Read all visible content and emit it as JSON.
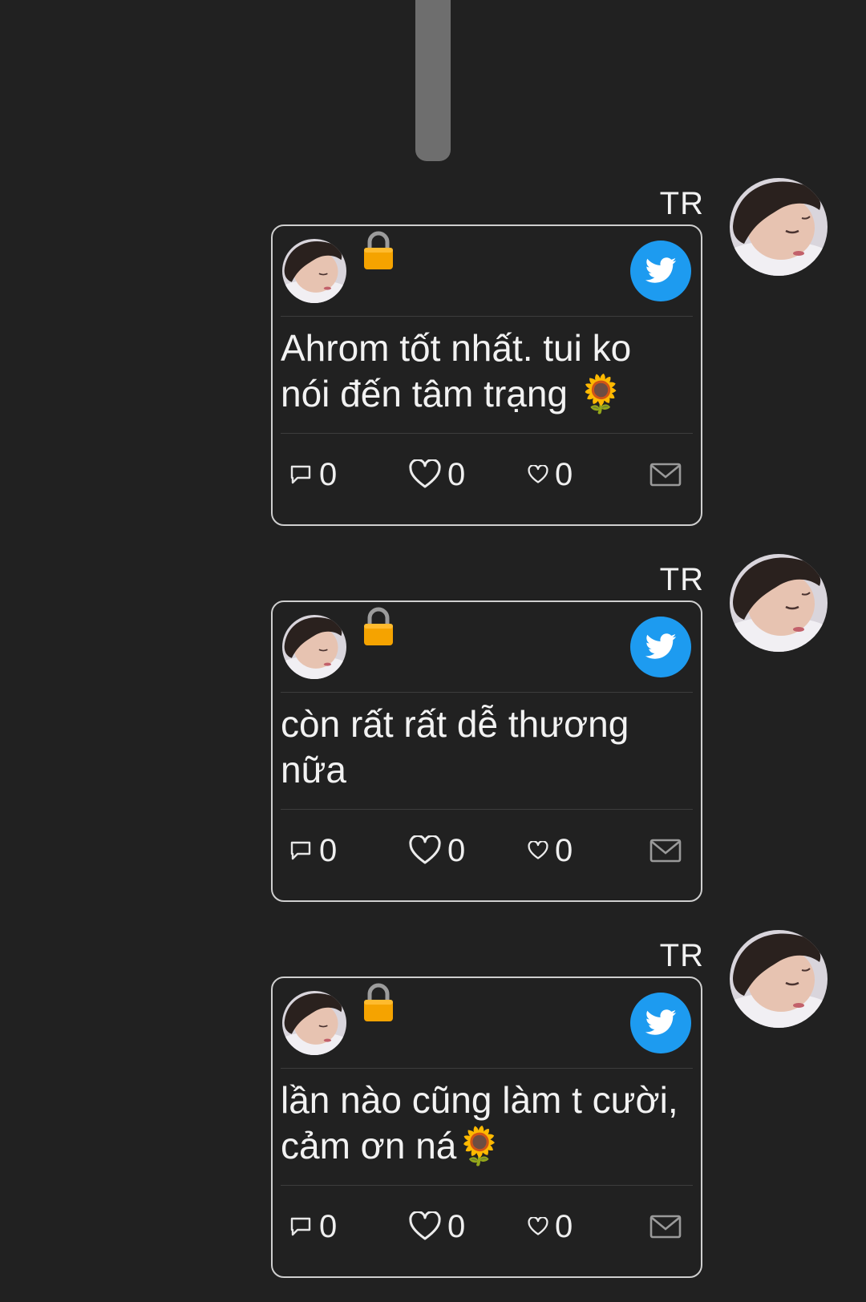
{
  "thread": {
    "messages": [
      {
        "sender": "TR",
        "text": "Ahrom tốt nhất. tui ko nói đến tâm trạng 🌻",
        "reply_count": "0",
        "like_count": "0",
        "fav_count": "0"
      },
      {
        "sender": "TR",
        "text": "còn rất rất dễ thương nữa",
        "reply_count": "0",
        "like_count": "0",
        "fav_count": "0"
      },
      {
        "sender": "TR",
        "text": "lần nào cũng làm t cười, cảm ơn ná🌻",
        "reply_count": "0",
        "like_count": "0",
        "fav_count": "0"
      }
    ]
  },
  "icons": {
    "lock": "lock-icon",
    "twitter": "twitter-bird-icon",
    "reply": "reply-bubble-icon",
    "like": "heart-icon",
    "fav": "small-heart-icon",
    "mail": "envelope-icon"
  },
  "colors": {
    "background": "#212121",
    "twitter_blue": "#1d9bf0",
    "lock_gold": "#f5a300",
    "card_border": "#cfcfcf"
  }
}
